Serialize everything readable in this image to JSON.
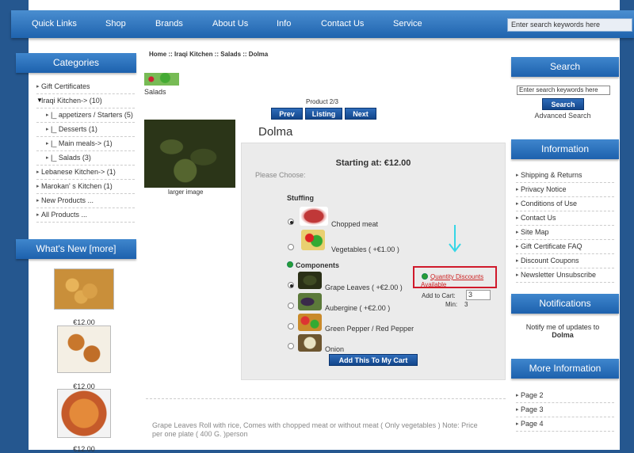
{
  "topnav": {
    "items": [
      "Quick Links",
      "Shop",
      "Brands",
      "About Us",
      "Info",
      "Contact Us",
      "Service"
    ],
    "search_placeholder": "Enter search keywords here"
  },
  "categories": {
    "title": "Categories",
    "items": [
      {
        "label": "Gift Certificates",
        "level": 0
      },
      {
        "label": "Iraqi Kitchen-> (10)",
        "level": 0,
        "open": true
      },
      {
        "label": "|_ appetizers / Starters (5)",
        "level": 1
      },
      {
        "label": "|_ Desserts (1)",
        "level": 1
      },
      {
        "label": "|_ Main meals-> (1)",
        "level": 1
      },
      {
        "label": "|_ Salads (3)",
        "level": 1
      },
      {
        "label": "Lebanese Kitchen-> (1)",
        "level": 0
      },
      {
        "label": "Marokan' s Kitchen (1)",
        "level": 0
      },
      {
        "label": "New Products ...",
        "level": 0
      },
      {
        "label": "All Products ...",
        "level": 0
      }
    ]
  },
  "whats_new": {
    "title": "What's New  [more]",
    "prices": [
      "€12.00",
      "€12.00",
      "€12.00"
    ]
  },
  "breadcrumb": "Home :: Iraqi Kitchen :: Salads :: Dolma",
  "category_thumb_label": "Salads",
  "product_nav": {
    "counter": "Product 2/3",
    "prev": "Prev",
    "listing": "Listing",
    "next": "Next"
  },
  "product": {
    "title": "Dolma",
    "larger_image": "larger image",
    "starting_at": "Starting at: €12.00",
    "please_choose": "Please Choose:",
    "stuffing_label": "Stuffing",
    "stuffing_options": [
      {
        "label": "Chopped meat",
        "checked": true
      },
      {
        "label": "Vegetables ( +€1.00 )",
        "checked": false
      }
    ],
    "components_label": "Components",
    "component_options": [
      {
        "label": "Grape Leaves ( +€2.00 )",
        "checked": true
      },
      {
        "label": "Aubergine ( +€2.00 )",
        "checked": false
      },
      {
        "label": "Green Pepper / Red Pepper",
        "checked": false
      },
      {
        "label": "Onion",
        "checked": false
      }
    ],
    "quantity_discounts": "Quantity Discounts Available",
    "add_to_cart_label": "Add to Cart:",
    "quantity": "3",
    "min_label": "Min:",
    "min_value": "3",
    "add_button": "Add This To My Cart",
    "description": "Grape Leaves Roll with rice, Comes with chopped meat or without meat ( Only vegetables ) Note: Price per one plate ( 400 G. )person"
  },
  "search_box": {
    "title": "Search",
    "placeholder": "Enter search keywords here",
    "button": "Search",
    "advanced": "Advanced Search"
  },
  "information": {
    "title": "Information",
    "items": [
      "Shipping & Returns",
      "Privacy Notice",
      "Conditions of Use",
      "Contact Us",
      "Site Map",
      "Gift Certificate FAQ",
      "Discount Coupons",
      "Newsletter Unsubscribe"
    ]
  },
  "notifications": {
    "title": "Notifications",
    "text": "Notify me of updates to",
    "product": "Dolma"
  },
  "more_information": {
    "title": "More Information",
    "items": [
      "Page 2",
      "Page 3",
      "Page 4"
    ]
  },
  "colors": {
    "nav_blue": "#1f63ae",
    "background": "#25578f",
    "highlight_box": "#d0192b",
    "arrow": "#35d6e6"
  }
}
